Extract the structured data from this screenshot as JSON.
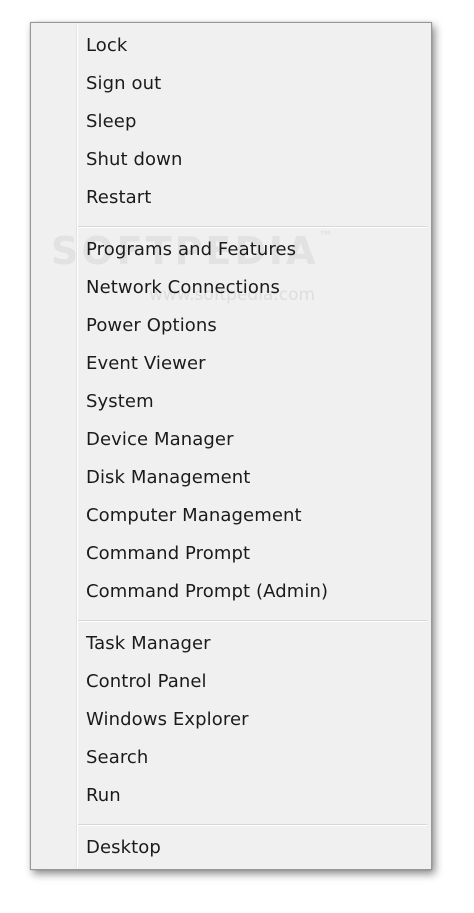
{
  "menu": {
    "items": [
      {
        "label": "Lock"
      },
      {
        "label": "Sign out"
      },
      {
        "label": "Sleep"
      },
      {
        "label": "Shut down"
      },
      {
        "label": "Restart"
      },
      {
        "label": "Programs and Features"
      },
      {
        "label": "Network Connections"
      },
      {
        "label": "Power Options"
      },
      {
        "label": "Event Viewer"
      },
      {
        "label": "System"
      },
      {
        "label": "Device Manager"
      },
      {
        "label": "Disk Management"
      },
      {
        "label": "Computer Management"
      },
      {
        "label": "Command Prompt"
      },
      {
        "label": "Command Prompt (Admin)"
      },
      {
        "label": "Task Manager"
      },
      {
        "label": "Control Panel"
      },
      {
        "label": "Windows Explorer"
      },
      {
        "label": "Search"
      },
      {
        "label": "Run"
      },
      {
        "label": "Desktop"
      }
    ]
  },
  "watermark": {
    "brand": "SOFTPEDIA",
    "trademark": "™",
    "url": "www.softpedia.com"
  }
}
